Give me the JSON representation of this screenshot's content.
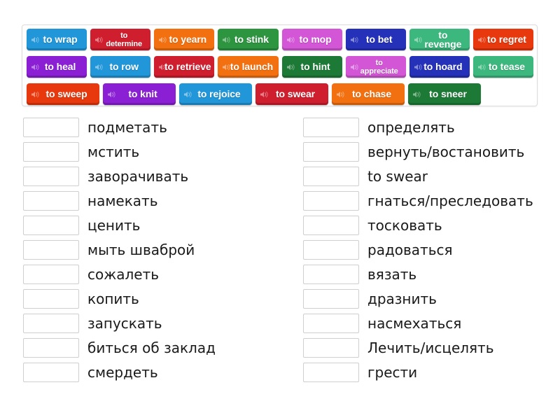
{
  "tile_tray": {
    "name": "word-tile-tray",
    "rows": [
      [
        {
          "label": "to wrap",
          "color": "#2196d8",
          "two_line": false,
          "icon": "speaker-icon"
        },
        {
          "label": "to\ndetermine",
          "color": "#cf1e2d",
          "two_line": true,
          "icon": "speaker-icon"
        },
        {
          "label": "to yearn",
          "color": "#f2700f",
          "two_line": false,
          "icon": "speaker-icon"
        },
        {
          "label": "to stink",
          "color": "#2d9440",
          "two_line": false,
          "icon": "speaker-icon"
        },
        {
          "label": "to mop",
          "color": "#d356d6",
          "two_line": false,
          "icon": "speaker-icon"
        },
        {
          "label": "to bet",
          "color": "#2431b8",
          "two_line": false,
          "icon": "speaker-icon"
        },
        {
          "label": "to revenge",
          "color": "#3cb87e",
          "two_line": false,
          "icon": "speaker-icon"
        },
        {
          "label": "to regret",
          "color": "#e8380d",
          "two_line": false,
          "icon": "speaker-icon"
        }
      ],
      [
        {
          "label": "to heal",
          "color": "#8a1fd4",
          "two_line": false,
          "icon": "speaker-icon"
        },
        {
          "label": "to row",
          "color": "#2196d8",
          "two_line": false,
          "icon": "speaker-icon"
        },
        {
          "label": "to retrieve",
          "color": "#cf1e2d",
          "two_line": false,
          "icon": "speaker-icon"
        },
        {
          "label": "to launch",
          "color": "#f2700f",
          "two_line": false,
          "icon": "speaker-icon"
        },
        {
          "label": "to hint",
          "color": "#1d7a36",
          "two_line": false,
          "icon": "speaker-icon"
        },
        {
          "label": "to\nappreciate",
          "color": "#d356d6",
          "two_line": true,
          "icon": "speaker-icon"
        },
        {
          "label": "to hoard",
          "color": "#2431b8",
          "two_line": false,
          "icon": "speaker-icon"
        },
        {
          "label": "to tease",
          "color": "#3cb87e",
          "two_line": false,
          "icon": "speaker-icon"
        }
      ],
      [
        {
          "label": "to sweep",
          "color": "#e8380d",
          "two_line": false,
          "icon": "speaker-icon"
        },
        {
          "label": "to knit",
          "color": "#8a1fd4",
          "two_line": false,
          "icon": "speaker-icon"
        },
        {
          "label": "to rejoice",
          "color": "#2196d8",
          "two_line": false,
          "icon": "speaker-icon"
        },
        {
          "label": "to swear",
          "color": "#cf1e2d",
          "two_line": false,
          "icon": "speaker-icon"
        },
        {
          "label": "to chase",
          "color": "#f2700f",
          "two_line": false,
          "icon": "speaker-icon"
        },
        {
          "label": "to sneer",
          "color": "#1d7a36",
          "two_line": false,
          "icon": "speaker-icon"
        }
      ]
    ]
  },
  "answers": {
    "left_column": [
      {
        "text": "подметать",
        "box_value": ""
      },
      {
        "text": "мстить",
        "box_value": ""
      },
      {
        "text": "заворачивать",
        "box_value": ""
      },
      {
        "text": "намекать",
        "box_value": ""
      },
      {
        "text": "ценить",
        "box_value": ""
      },
      {
        "text": "мыть шваброй",
        "box_value": ""
      },
      {
        "text": "сожалеть",
        "box_value": ""
      },
      {
        "text": "копить",
        "box_value": ""
      },
      {
        "text": "запускать",
        "box_value": ""
      },
      {
        "text": "биться об заклад",
        "box_value": ""
      },
      {
        "text": "смердеть",
        "box_value": ""
      }
    ],
    "right_column": [
      {
        "text": "определять",
        "box_value": ""
      },
      {
        "text": "вернуть/востановить",
        "box_value": ""
      },
      {
        "text": "to swear",
        "box_value": ""
      },
      {
        "text": "гнаться/преследовать",
        "box_value": ""
      },
      {
        "text": "тосковать",
        "box_value": ""
      },
      {
        "text": "радоваться",
        "box_value": ""
      },
      {
        "text": "вязать",
        "box_value": ""
      },
      {
        "text": "дразнить",
        "box_value": ""
      },
      {
        "text": "насмехаться",
        "box_value": ""
      },
      {
        "text": "Лечить/исцелять",
        "box_value": ""
      },
      {
        "text": "грести",
        "box_value": ""
      }
    ]
  },
  "colors": {
    "page_background": "#ffffff",
    "tray_border": "#dcdcdc",
    "drop_box_border": "#cfcfcf",
    "answer_text": "#1a1a1a"
  }
}
